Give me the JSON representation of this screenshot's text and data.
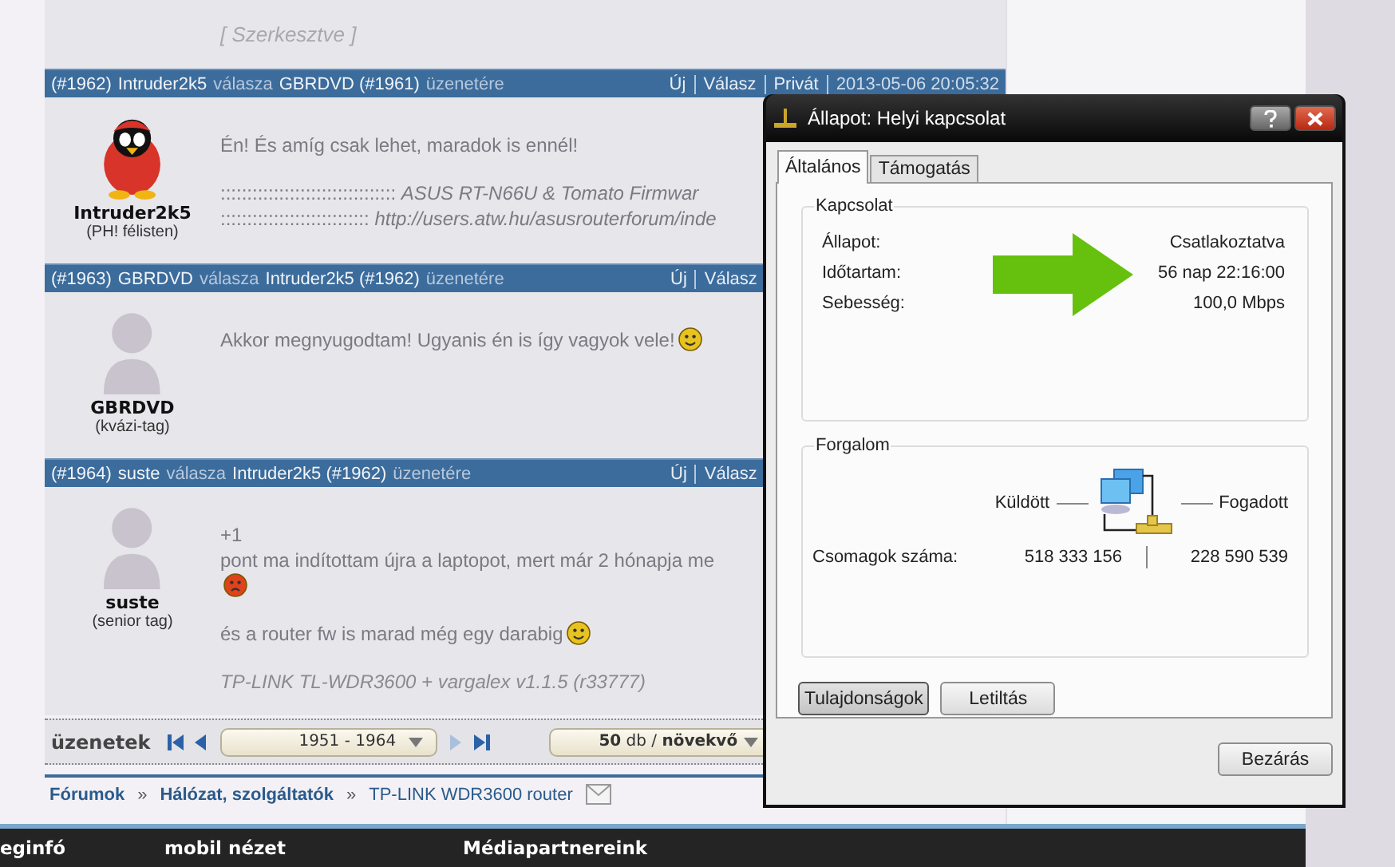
{
  "previous_post": {
    "edited_note": "[ Szerkesztve ]"
  },
  "posts": [
    {
      "number": "(#1962)",
      "author": "Intruder2k5",
      "verb": "válasza",
      "target": "GBRDVD (#1961)",
      "suffix": "üzenetére",
      "actions": [
        "Új",
        "Válasz",
        "Privát"
      ],
      "timestamp": "2013-05-06 20:05:32",
      "user": {
        "name": "Intruder2k5",
        "rank": "(PH! félisten)",
        "avatar": {
          "kind": "penguin"
        }
      },
      "blocks": [
        [
          {
            "kind": "text",
            "text": "Én! És amíg csak lehet, maradok is ennél!"
          }
        ],
        [
          {
            "kind": "text",
            "text": "::::::::::::::::::::::::::::::::: *ASUS RT-N66U & Tomato Firmwar*"
          },
          {
            "kind": "text",
            "text": ":::::::::::::::::::::::::::: *http://users.atw.hu/asusrouterforum/inde*"
          }
        ]
      ]
    },
    {
      "number": "(#1963)",
      "author": "GBRDVD",
      "verb": "válasza",
      "target": "Intruder2k5 (#1962)",
      "suffix": "üzenetére",
      "actions": [
        "Új",
        "Válasz"
      ],
      "user": {
        "name": "GBRDVD",
        "rank": "(kvázi-tag)",
        "avatar": {
          "kind": "person"
        }
      },
      "blocks": [
        [
          {
            "kind": "text",
            "text": "Akkor megnyugodtam! Ugyanis én is így vagyok vele!",
            "smiley": {
              "kind": "happy"
            }
          }
        ]
      ]
    },
    {
      "number": "(#1964)",
      "author": "suste",
      "verb": "válasza",
      "target": "Intruder2k5 (#1962)",
      "suffix": "üzenetére",
      "actions": [
        "Új",
        "Válasz"
      ],
      "user": {
        "name": "suste",
        "rank": "(senior tag)",
        "avatar": {
          "kind": "person"
        }
      },
      "blocks": [
        [
          {
            "kind": "text",
            "text": "+1"
          },
          {
            "kind": "text",
            "text": "pont ma indítottam újra a laptopot, mert már 2 hónapja me"
          },
          {
            "kind": "smiley",
            "smiley": {
              "kind": "angry"
            }
          }
        ],
        [
          {
            "kind": "text",
            "text": "és a router fw is marad még egy darabig",
            "smiley": {
              "kind": "happy"
            }
          }
        ],
        [
          {
            "kind": "signature",
            "text": "TP-LINK TL-WDR3600 + vargalex v1.1.5 (r33777)"
          }
        ]
      ]
    }
  ],
  "pagination": {
    "label": "üzenetek",
    "nav": [
      {
        "kind": "first",
        "disabled": false
      },
      {
        "kind": "prev",
        "disabled": false
      },
      {
        "kind": "range"
      },
      {
        "kind": "next",
        "disabled": true
      },
      {
        "kind": "last",
        "disabled": false
      }
    ],
    "range": "1951 - 1964",
    "order": "**50** db / **növekvő**"
  },
  "breadcrumb": [
    {
      "kind": "link",
      "text": "Fórumok"
    },
    {
      "kind": "separator",
      "text": "»"
    },
    {
      "kind": "link",
      "text": "Hálózat, szolgáltatók"
    },
    {
      "kind": "separator",
      "text": "»"
    },
    {
      "kind": "current",
      "text": "TP-LINK WDR3600 router"
    }
  ],
  "footer": [
    "eginfó",
    "mobil nézet",
    "Médiapartnereink"
  ],
  "dialog": {
    "title": "Állapot: Helyi kapcsolat",
    "tabs": [
      {
        "label": "Általános",
        "selected": true
      },
      {
        "label": "Támogatás",
        "selected": false
      }
    ],
    "connection": {
      "title": "Kapcsolat",
      "rows": [
        {
          "label": "Állapot:",
          "value": "Csatlakoztatva"
        },
        {
          "label": "Időtartam:",
          "value": "56 nap 22:16:00"
        },
        {
          "label": "Sebesség:",
          "value": "100,0 Mbps"
        }
      ]
    },
    "traffic": {
      "title": "Forgalom",
      "sent_label": "Küldött",
      "received_label": "Fogadott",
      "packets_label": "Csomagok száma:",
      "sent": "518 333 156",
      "received": "228 590 539"
    },
    "buttons": [
      {
        "label": "Tulajdonságok",
        "focused": true
      },
      {
        "label": "Letiltás",
        "focused": false
      }
    ],
    "close_button": "Bezárás"
  }
}
